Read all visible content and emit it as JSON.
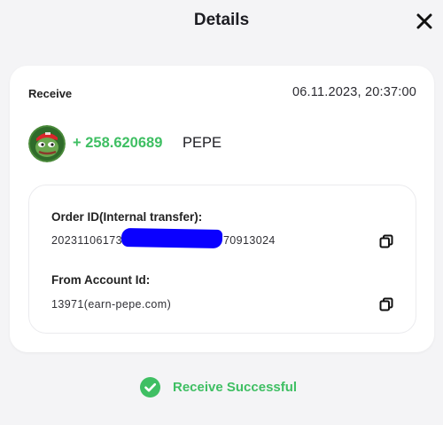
{
  "header": {
    "title": "Details"
  },
  "transaction": {
    "type": "Receive",
    "datetime": "06.11.2023, 20:37:00",
    "amount": "+ 258.620689",
    "token": "PEPE"
  },
  "details": {
    "order_id_label": "Order ID(Internal transfer):",
    "order_id_prefix": "20231106173",
    "order_id_suffix": "70913024",
    "from_account_label": "From Account Id:",
    "from_account_value": "13971(earn-pepe.com)"
  },
  "status": {
    "text": "Receive Successful"
  },
  "colors": {
    "success_green": "#3fbf63",
    "redaction_blue": "#0a00ff",
    "background": "#f4f4f6",
    "card": "#ffffff"
  },
  "icons": {
    "close": "close-icon",
    "copy": "copy-icon",
    "check": "check-circle-icon",
    "avatar": "pepe-token-avatar"
  }
}
